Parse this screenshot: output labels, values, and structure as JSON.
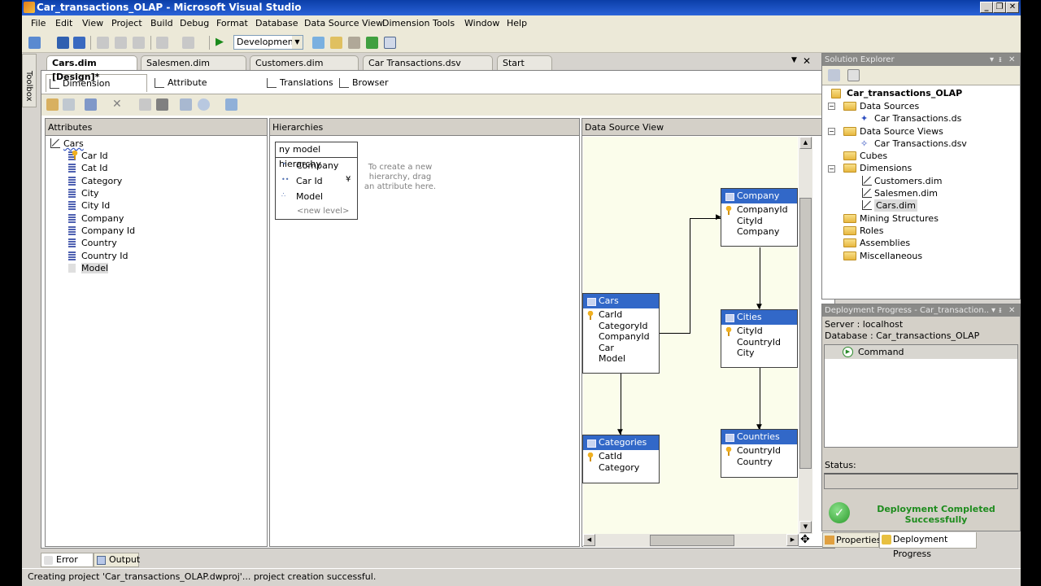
{
  "window": {
    "title": "Car_transactions_OLAP - Microsoft Visual Studio",
    "controls": {
      "minimize": "_",
      "restore": "❐",
      "close": "✕"
    }
  },
  "menu": [
    "File",
    "Edit",
    "View",
    "Project",
    "Build",
    "Debug",
    "Format",
    "Database",
    "Data Source View",
    "Dimension",
    "Tools",
    "Window",
    "Help"
  ],
  "toolbar": {
    "configuration": "Development",
    "icons": [
      "new-project-icon",
      "save-icon",
      "save-all-icon",
      "cut-icon",
      "copy-icon",
      "paste-icon",
      "undo-icon",
      "redo-icon",
      "start-debug-icon",
      "properties-icon",
      "deploy-icon",
      "tools-icon",
      "process-icon",
      "command-window-icon"
    ]
  },
  "toolbox": {
    "label": "Toolbox"
  },
  "doc_tabs": [
    {
      "label": "Cars.dim [Design]*",
      "active": true
    },
    {
      "label": "Salesmen.dim [Design]",
      "active": false
    },
    {
      "label": "Customers.dim [Design]",
      "active": false
    },
    {
      "label": "Car Transactions.dsv [Design]",
      "active": false
    },
    {
      "label": "Start Page",
      "active": false
    }
  ],
  "designer_tabs": [
    {
      "label": "Dimension Structure",
      "active": true
    },
    {
      "label": "Attribute Relationships",
      "active": false
    },
    {
      "label": "Translations",
      "active": false
    },
    {
      "label": "Browser",
      "active": false
    }
  ],
  "attributes": {
    "header": "Attributes",
    "dimension": "Cars",
    "items": [
      {
        "label": "Car Id",
        "key": true
      },
      {
        "label": "Cat Id"
      },
      {
        "label": "Category"
      },
      {
        "label": "City"
      },
      {
        "label": "City Id"
      },
      {
        "label": "Company"
      },
      {
        "label": "Company Id"
      },
      {
        "label": "Country"
      },
      {
        "label": "Country Id"
      },
      {
        "label": "Model",
        "selected": true
      }
    ]
  },
  "hierarchies": {
    "header": "Hierarchies",
    "hierarchy_name": "ny model hierarchy",
    "levels": [
      "Company",
      "Car Id",
      "Model"
    ],
    "new_level": "<new level>",
    "hint": "To create a new hierarchy, drag an attribute here."
  },
  "dsv": {
    "header": "Data Source View",
    "tables": [
      {
        "name": "Company",
        "columns": [
          "CompanyId",
          "CityId",
          "Company"
        ]
      },
      {
        "name": "Cars",
        "columns": [
          "CarId",
          "CategoryId",
          "CompanyId",
          "Car",
          "Model"
        ]
      },
      {
        "name": "Cities",
        "columns": [
          "CityId",
          "CountryId",
          "City"
        ]
      },
      {
        "name": "Categories",
        "columns": [
          "CatId",
          "Category"
        ]
      },
      {
        "name": "Countries",
        "columns": [
          "CountryId",
          "Country"
        ]
      }
    ]
  },
  "solution_explorer": {
    "title": "Solution Explorer",
    "project": "Car_transactions_OLAP",
    "nodes": [
      {
        "label": "Data Sources"
      },
      {
        "label": "Car Transactions.ds"
      },
      {
        "label": "Data Source Views"
      },
      {
        "label": "Car Transactions.dsv"
      },
      {
        "label": "Cubes"
      },
      {
        "label": "Dimensions"
      },
      {
        "label": "Customers.dim"
      },
      {
        "label": "Salesmen.dim"
      },
      {
        "label": "Cars.dim"
      },
      {
        "label": "Mining Structures"
      },
      {
        "label": "Roles"
      },
      {
        "label": "Assemblies"
      },
      {
        "label": "Miscellaneous"
      }
    ]
  },
  "deployment": {
    "title": "Deployment Progress - Car_transaction...",
    "server": "Server :  localhost",
    "database": "Database : Car_transactions_OLAP",
    "command": "Command",
    "status_label": "Status:",
    "status_value": "",
    "result_line1": "Deployment Completed",
    "result_line2": "Successfully",
    "success_color": "#1e8c1e"
  },
  "bottom_tabs": {
    "right": [
      "Properties",
      "Deployment Progress"
    ],
    "left": [
      "Error List",
      "Output"
    ]
  },
  "statusbar": {
    "text": "Creating project 'Car_transactions_OLAP.dwproj'... project creation successful."
  }
}
